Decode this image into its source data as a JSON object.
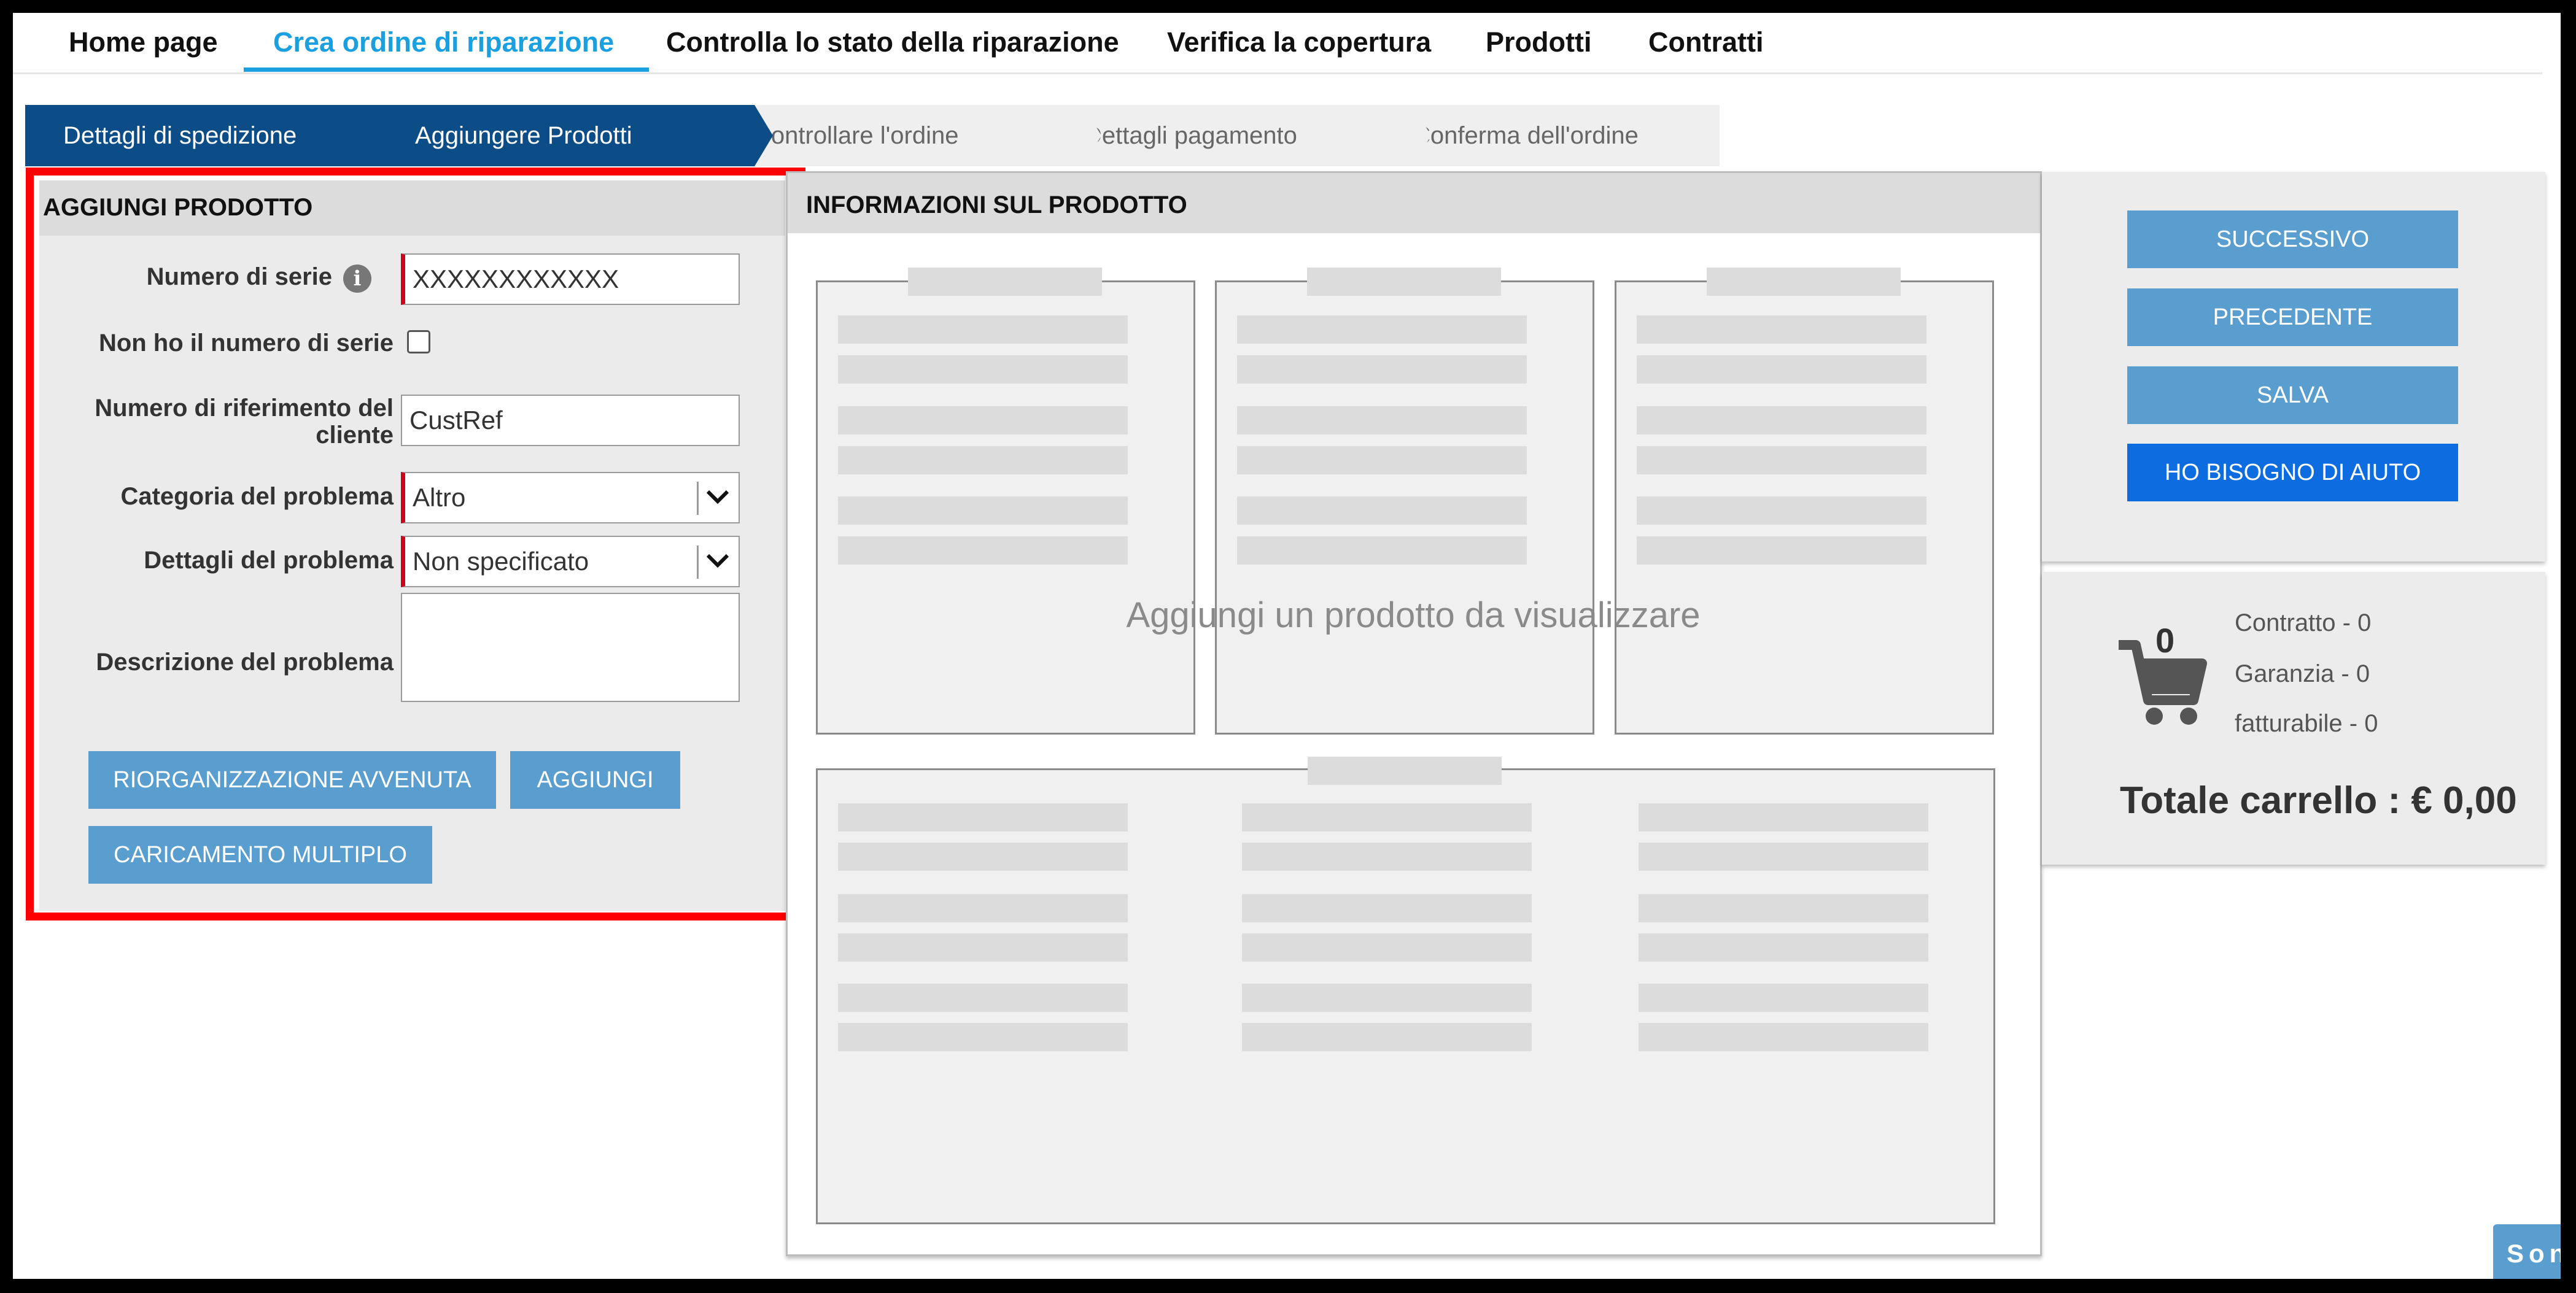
{
  "nav": {
    "items": [
      "Home page",
      "Crea ordine di riparazione",
      "Controlla lo stato della riparazione",
      "Verifica la copertura",
      "Prodotti",
      "Contratti"
    ],
    "active_index": 1,
    "accent_color": "#1aa0e0"
  },
  "steps": [
    {
      "label": "Dettagli di spedizione",
      "state": "completed"
    },
    {
      "label": "Aggiungere Prodotti",
      "state": "current"
    },
    {
      "label": "Controllare l'ordine",
      "state": "pending"
    },
    {
      "label": "Dettagli pagamento",
      "state": "pending"
    },
    {
      "label": "Conferma dell'ordine",
      "state": "pending"
    }
  ],
  "add_product": {
    "title": "AGGIUNGI PRODOTTO",
    "serial_label": "Numero di serie",
    "serial_value": "XXXXXXXXXXXX",
    "no_serial_label": "Non ho il numero di serie",
    "no_serial_checked": false,
    "customer_ref_label_line1": "Numero di riferimento del",
    "customer_ref_label_line2": "cliente",
    "customer_ref_value": "CustRef",
    "problem_category_label": "Categoria del problema",
    "problem_category_value": "Altro",
    "problem_details_label": "Dettagli del problema",
    "problem_details_value": "Non specificato",
    "problem_description_label": "Descrizione del problema",
    "problem_description_value": "",
    "btn_reorganization": "RIORGANIZZAZIONE AVVENUTA",
    "btn_add": "AGGIUNGI",
    "btn_bulk_upload": "CARICAMENTO MULTIPLO",
    "highlight_color": "#ff0000"
  },
  "product_info": {
    "title": "INFORMAZIONI SUL PRODOTTO",
    "placeholder": "Aggiungi un prodotto da visualizzare"
  },
  "actions": {
    "next": "SUCCESSIVO",
    "previous": "PRECEDENTE",
    "save": "SALVA",
    "help": "HO BISOGNO DI AIUTO"
  },
  "cart": {
    "count": "0",
    "contract": "Contratto - 0",
    "warranty": "Garanzia - 0",
    "billable": "fatturabile - 0",
    "total": "Totale carrello : € 0,00"
  },
  "chat_tab": "Son"
}
